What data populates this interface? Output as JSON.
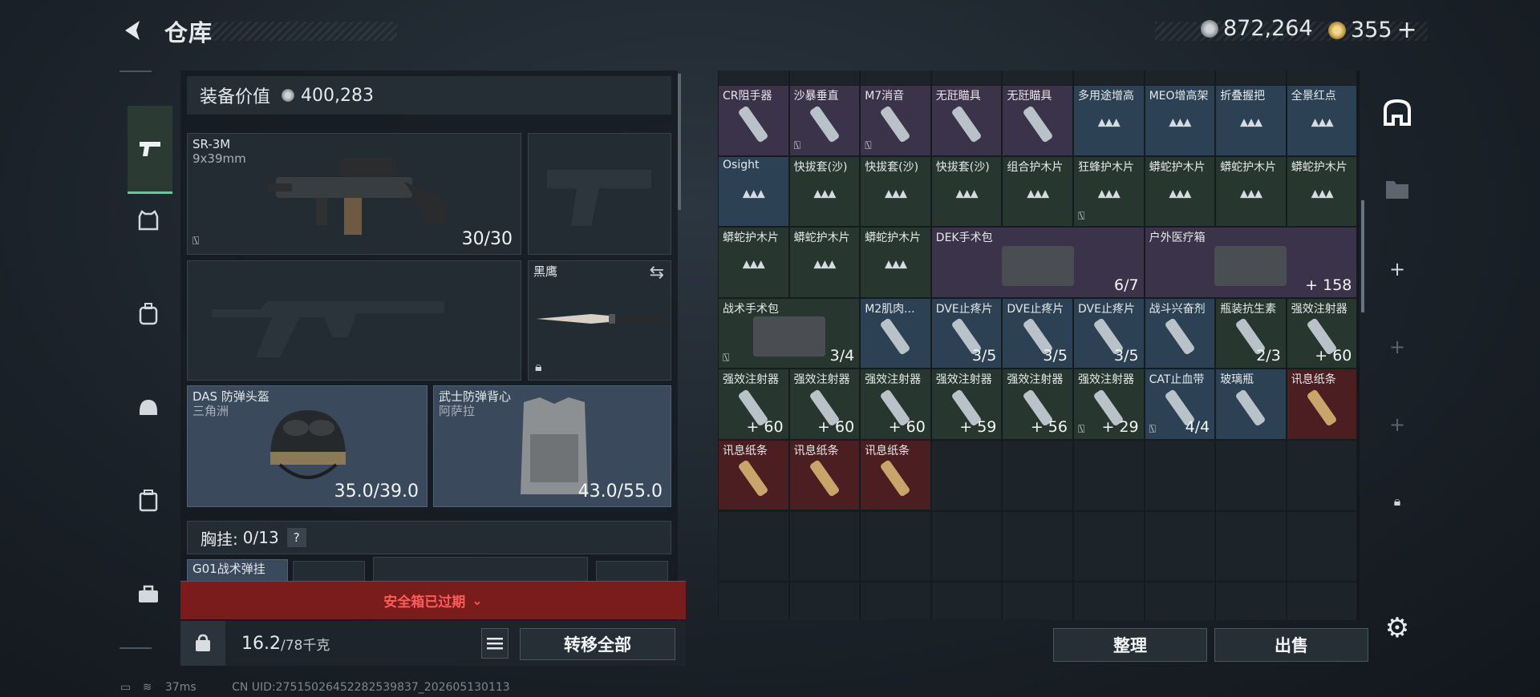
{
  "header": {
    "title": "仓库",
    "currency1": "872,264",
    "currency2": "355",
    "plus": "+"
  },
  "sidebar": {
    "icons": [
      "pistol-icon",
      "vest-icon",
      "backpack-icon",
      "helmet-icon",
      "case-icon",
      "toolbox-icon"
    ]
  },
  "equipment": {
    "value_label": "装备价值",
    "value": "400,283",
    "primary": {
      "name": "SR-3M",
      "caliber": "9x39mm",
      "ammo": "30/30"
    },
    "melee": {
      "name": "黑鹰"
    },
    "helmet": {
      "name": "DAS 防弹头盔",
      "sub": "三角洲",
      "durability": "35.0/39.0"
    },
    "armor": {
      "name": "武士防弹背心",
      "sub": "阿萨拉",
      "durability": "43.0/55.0"
    },
    "chest": {
      "label": "胸挂:",
      "value": "0/13",
      "help": "?"
    },
    "rig_name": "G01战术弹挂",
    "safebox": "安全箱已过期",
    "weight": "16.2",
    "weight_max": "/78千克",
    "transfer_all": "转移全部"
  },
  "grid": {
    "row0": [
      {
        "n": "CR阻手器"
      },
      {
        "n": "沙暴垂直"
      },
      {
        "n": "M7消音"
      },
      {
        "n": "无瓩瞄具"
      },
      {
        "n": "无瓩瞄具"
      },
      {
        "n": "多用途增高"
      },
      {
        "n": "MEO增高架"
      },
      {
        "n": "折叠握把"
      },
      {
        "n": "全景红点"
      }
    ],
    "row1": [
      {
        "n": "Osight"
      },
      {
        "n": "快拔套(沙)"
      },
      {
        "n": "快拔套(沙)"
      },
      {
        "n": "快拔套(沙)"
      },
      {
        "n": "组合护木片"
      },
      {
        "n": "狂蜂护木片"
      },
      {
        "n": "蟒蛇护木片"
      },
      {
        "n": "蟒蛇护木片"
      },
      {
        "n": "蟒蛇护木片"
      }
    ],
    "row2": [
      {
        "n": "蟒蛇护木片"
      },
      {
        "n": "蟒蛇护木片"
      },
      {
        "n": "蟒蛇护木片"
      },
      {
        "n": "DEK手术包",
        "q": "6/7"
      },
      {
        "n": "户外医疗箱",
        "q": "+ 158"
      }
    ],
    "row3": [
      {
        "n": "战术手术包",
        "q": "3/4"
      },
      {
        "n": "M2肌肉...",
        "q": ""
      },
      {
        "n": "DVE止疼片",
        "q": "3/5"
      },
      {
        "n": "DVE止疼片",
        "q": "3/5"
      },
      {
        "n": "DVE止疼片",
        "q": "3/5"
      },
      {
        "n": "战斗兴奋剂",
        "q": ""
      },
      {
        "n": "瓶装抗生素",
        "q": "2/3"
      },
      {
        "n": "强效注射器",
        "q": "+ 60"
      }
    ],
    "row4": [
      {
        "n": "强效注射器",
        "q": "+ 60"
      },
      {
        "n": "强效注射器",
        "q": "+ 60"
      },
      {
        "n": "强效注射器",
        "q": "+ 60"
      },
      {
        "n": "强效注射器",
        "q": "+ 59"
      },
      {
        "n": "强效注射器",
        "q": "+ 56"
      },
      {
        "n": "强效注射器",
        "q": "+ 29"
      },
      {
        "n": "CAT止血带",
        "q": "4/4"
      },
      {
        "n": "玻璃瓶",
        "q": ""
      },
      {
        "n": "讯息纸条",
        "q": ""
      }
    ],
    "row5": [
      {
        "n": "讯息纸条"
      },
      {
        "n": "讯息纸条"
      },
      {
        "n": "讯息纸条"
      }
    ],
    "sort": "整理",
    "sell": "出售"
  },
  "status": {
    "ping": "37ms",
    "uid": "CN UID:27515026452282539837_202605130113"
  }
}
